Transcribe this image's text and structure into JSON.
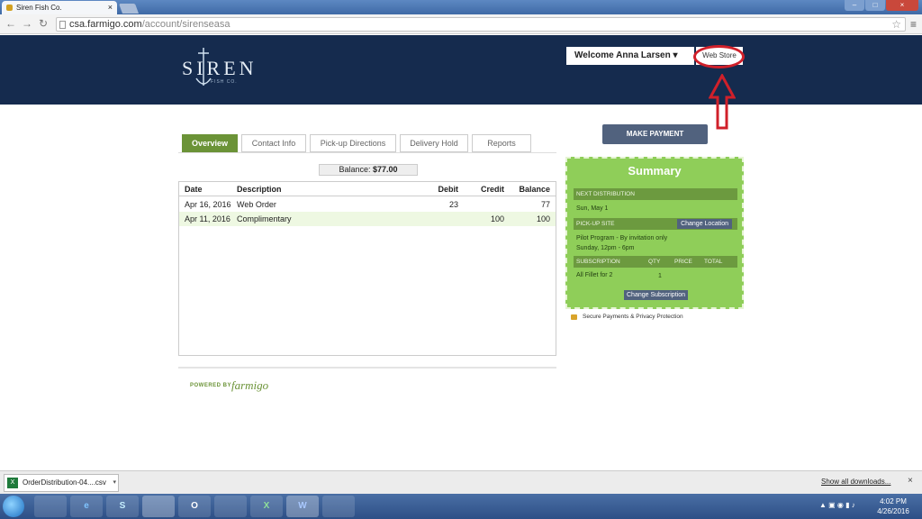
{
  "browser": {
    "tab_title": "Siren Fish Co.",
    "tab_close": "×",
    "url_host": "csa.farmigo.com",
    "url_path": "/account/sirenseasa"
  },
  "header": {
    "logo_text": "SIREN",
    "logo_sub": "FISH CO.",
    "welcome": "Welcome Anna Larsen ▾",
    "web_store": "Web Store"
  },
  "tabs": [
    "Overview",
    "Contact Info",
    "Pick-up Directions",
    "Delivery Hold",
    "Reports"
  ],
  "balance": {
    "label": "Balance:",
    "value": "$77.00"
  },
  "table": {
    "headers": {
      "date": "Date",
      "description": "Description",
      "debit": "Debit",
      "credit": "Credit",
      "balance": "Balance"
    },
    "rows": [
      {
        "date": "Apr 16, 2016",
        "description": "Web Order",
        "debit": "23",
        "credit": "",
        "balance": "77"
      },
      {
        "date": "Apr 11, 2016",
        "description": "Complimentary",
        "debit": "",
        "credit": "100",
        "balance": "100"
      }
    ]
  },
  "footer": {
    "powered_by": "POWERED BY",
    "brand": "farmigo"
  },
  "make_payment": "MAKE PAYMENT",
  "summary": {
    "title": "Summary",
    "next_distribution_label": "NEXT DISTRIBUTION",
    "next_distribution_value": "Sun, May 1",
    "pickup_label": "PICK-UP SITE",
    "change_location": "Change Location",
    "pickup_name": "Pilot Program - By invitation only",
    "pickup_time": "Sunday, 12pm - 6pm",
    "sub_headers": {
      "subscription": "SUBSCRIPTION",
      "qty": "QTY",
      "price": "PRICE",
      "total": "TOTAL"
    },
    "sub_item": "All Fillet for 2",
    "sub_qty": "1",
    "change_subscription": "Change Subscription"
  },
  "secure_text": "Secure Payments & Privacy Protection",
  "downloads": {
    "file": "OrderDistribution-04....csv",
    "show_all": "Show all downloads...",
    "close": "×"
  },
  "taskbar": {
    "apps": [
      "",
      "e",
      "S",
      "",
      "O",
      "",
      "X",
      "W",
      ""
    ],
    "time": "4:02 PM",
    "date": "4/26/2016"
  },
  "colors": {
    "header_navy": "#152b4e",
    "accent_green": "#6b9337",
    "summary_green": "#8fce59",
    "button_slate": "#51627e",
    "annotation_red": "#d0202a"
  }
}
